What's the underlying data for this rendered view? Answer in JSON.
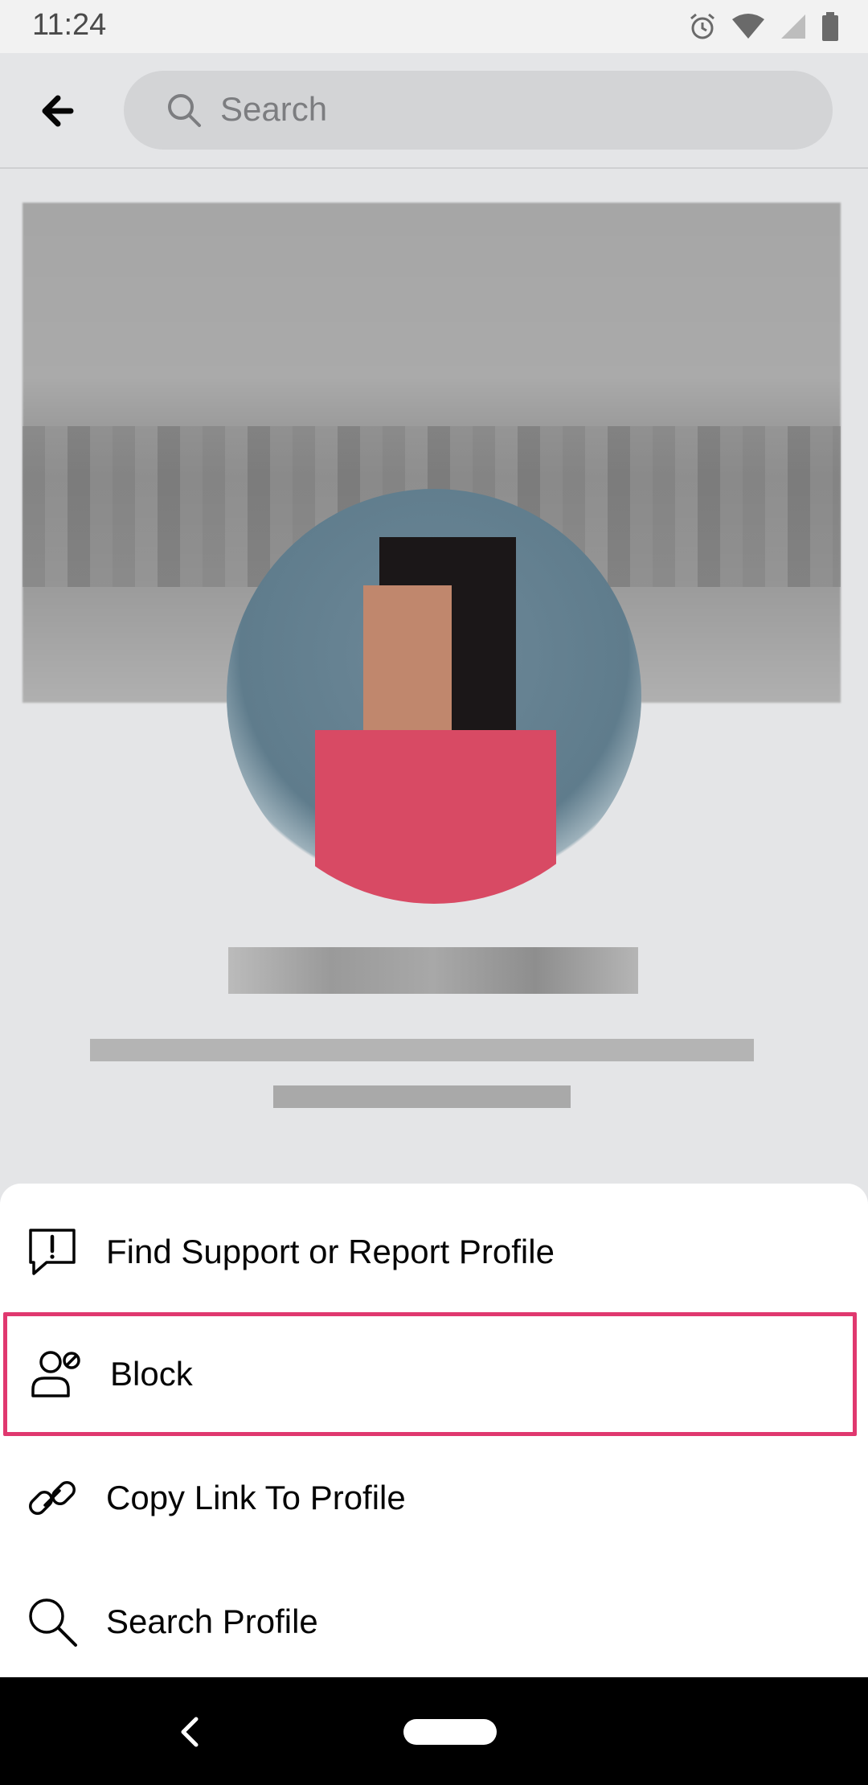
{
  "status_bar": {
    "time": "11:24"
  },
  "search": {
    "placeholder": "Search"
  },
  "menu": {
    "items": [
      {
        "label": "Find Support or Report Profile",
        "icon": "report-icon"
      },
      {
        "label": "Block",
        "icon": "block-person-icon",
        "highlighted": true
      },
      {
        "label": "Copy Link To Profile",
        "icon": "link-icon"
      },
      {
        "label": "Search Profile",
        "icon": "search-icon"
      }
    ]
  },
  "colors": {
    "highlight": "#e0386f",
    "overlay": "#e4e5e7",
    "sheet": "#ffffff"
  }
}
